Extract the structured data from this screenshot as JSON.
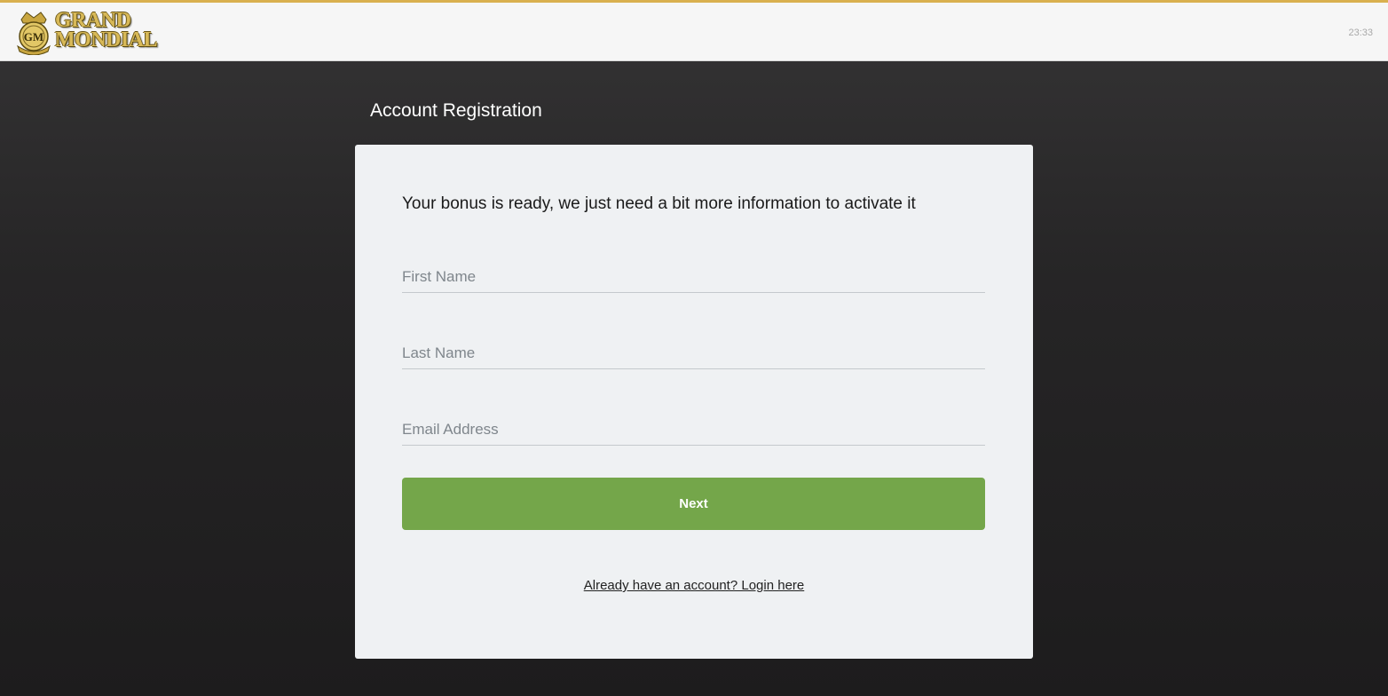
{
  "header": {
    "logo_line1": "GRAND",
    "logo_line2": "MONDIAL",
    "clock": "23:33"
  },
  "page": {
    "title": "Account Registration"
  },
  "form": {
    "intro": "Your bonus is ready, we just need a bit more information to activate it",
    "first_name_placeholder": "First Name",
    "last_name_placeholder": "Last Name",
    "email_placeholder": "Email Address",
    "next_label": "Next",
    "login_link": "Already have an account? Login here"
  },
  "colors": {
    "accent_gold": "#d9b04f",
    "button_green": "#74a64a",
    "card_bg": "#eff1f3"
  },
  "icons": {
    "logo_emblem": "crest-emblem-icon"
  }
}
